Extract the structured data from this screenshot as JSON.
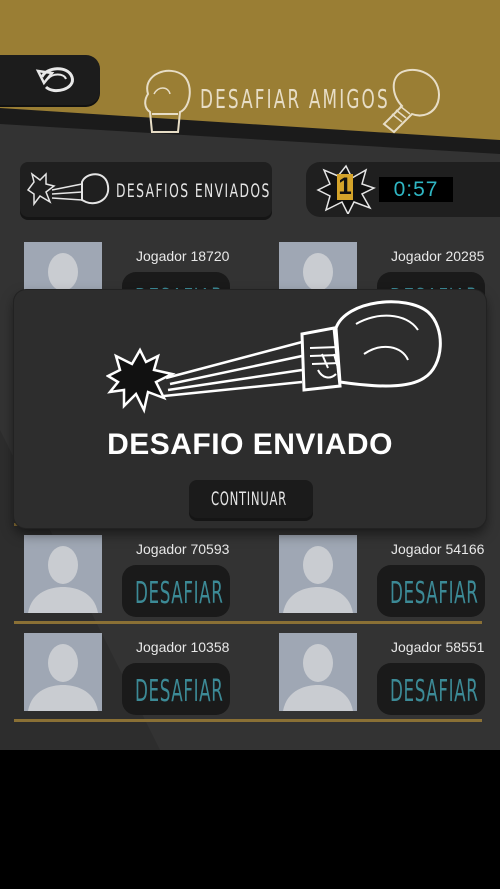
{
  "header": {
    "title": "DESAFIAR AMIGOS",
    "back_icon": "undo-arrow-icon"
  },
  "tabs": {
    "sent_label": "DESAFIOS ENVIADOS"
  },
  "status": {
    "counter": "1",
    "timer": "0:57"
  },
  "players": [
    {
      "name": "Jogador 18720",
      "button": "DESAFIAR"
    },
    {
      "name": "Jogador 20285",
      "button": "DESAFIAR"
    },
    {
      "name": "Jogador 70593",
      "button": "DESAFIAR"
    },
    {
      "name": "Jogador 54166",
      "button": "DESAFIAR"
    },
    {
      "name": "Jogador 10358",
      "button": "DESAFIAR"
    },
    {
      "name": "Jogador 58551",
      "button": "DESAFIAR"
    }
  ],
  "modal": {
    "title": "DESAFIO ENVIADO",
    "continue_label": "CONTINUAR",
    "icon": "punching-glove-icon"
  },
  "colors": {
    "header_gold": "#9a7e34",
    "button_text_teal": "#3c8a96",
    "timer_cyan": "#2fb6c3",
    "counter_gold": "#d4a32a"
  }
}
